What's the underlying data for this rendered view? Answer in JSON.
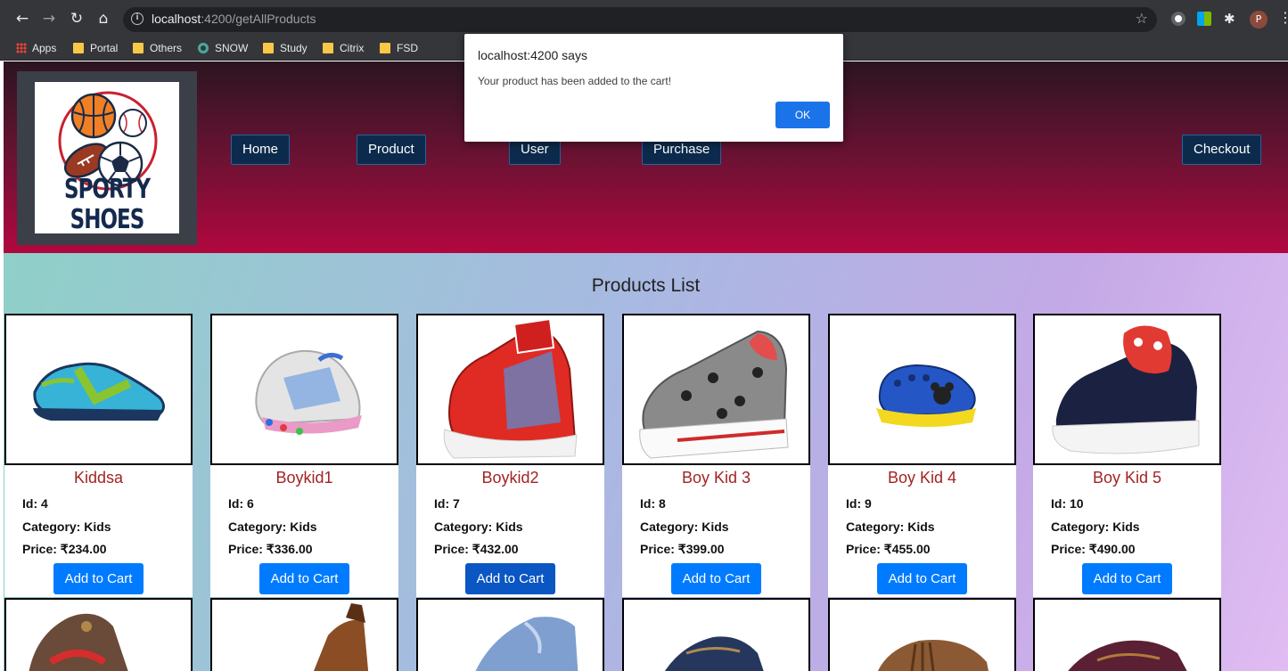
{
  "browser": {
    "url_host": "localhost",
    "url_path": ":4200/getAllProducts",
    "profile_initial": "P",
    "bookmarks": [
      "Apps",
      "Portal",
      "Others",
      "SNOW",
      "Study",
      "Citrix",
      "FSD"
    ]
  },
  "header": {
    "logo_text": "SPORTY SHOES",
    "nav": {
      "home": "Home",
      "product": "Product",
      "user": "User",
      "purchase": "Purchase",
      "checkout": "Checkout"
    }
  },
  "main": {
    "title": "Products List",
    "products": [
      {
        "name": "Kiddsa",
        "id": "Id: 4",
        "category": "Category: Kids",
        "price": "Price: ₹234.00",
        "button": "Add to Cart"
      },
      {
        "name": "Boykid1",
        "id": "Id: 6",
        "category": "Category: Kids",
        "price": "Price: ₹336.00",
        "button": "Add to Cart"
      },
      {
        "name": "Boykid2",
        "id": "Id: 7",
        "category": "Category: Kids",
        "price": "Price: ₹432.00",
        "button": "Add to Cart"
      },
      {
        "name": "Boy Kid 3",
        "id": "Id: 8",
        "category": "Category: Kids",
        "price": "Price: ₹399.00",
        "button": "Add to Cart"
      },
      {
        "name": "Boy Kid 4",
        "id": "Id: 9",
        "category": "Category: Kids",
        "price": "Price: ₹455.00",
        "button": "Add to Cart"
      },
      {
        "name": "Boy Kid 5",
        "id": "Id: 10",
        "category": "Category: Kids",
        "price": "Price: ₹490.00",
        "button": "Add to Cart"
      }
    ]
  },
  "dialog": {
    "title": "localhost:4200 says",
    "message": "Your product has been added to the cart!",
    "ok": "OK"
  },
  "colors": {
    "button_primary": "#007bff",
    "product_name": "#a42323",
    "nav_button": "#0c2b4c",
    "header_bottom": "#b2073f"
  }
}
